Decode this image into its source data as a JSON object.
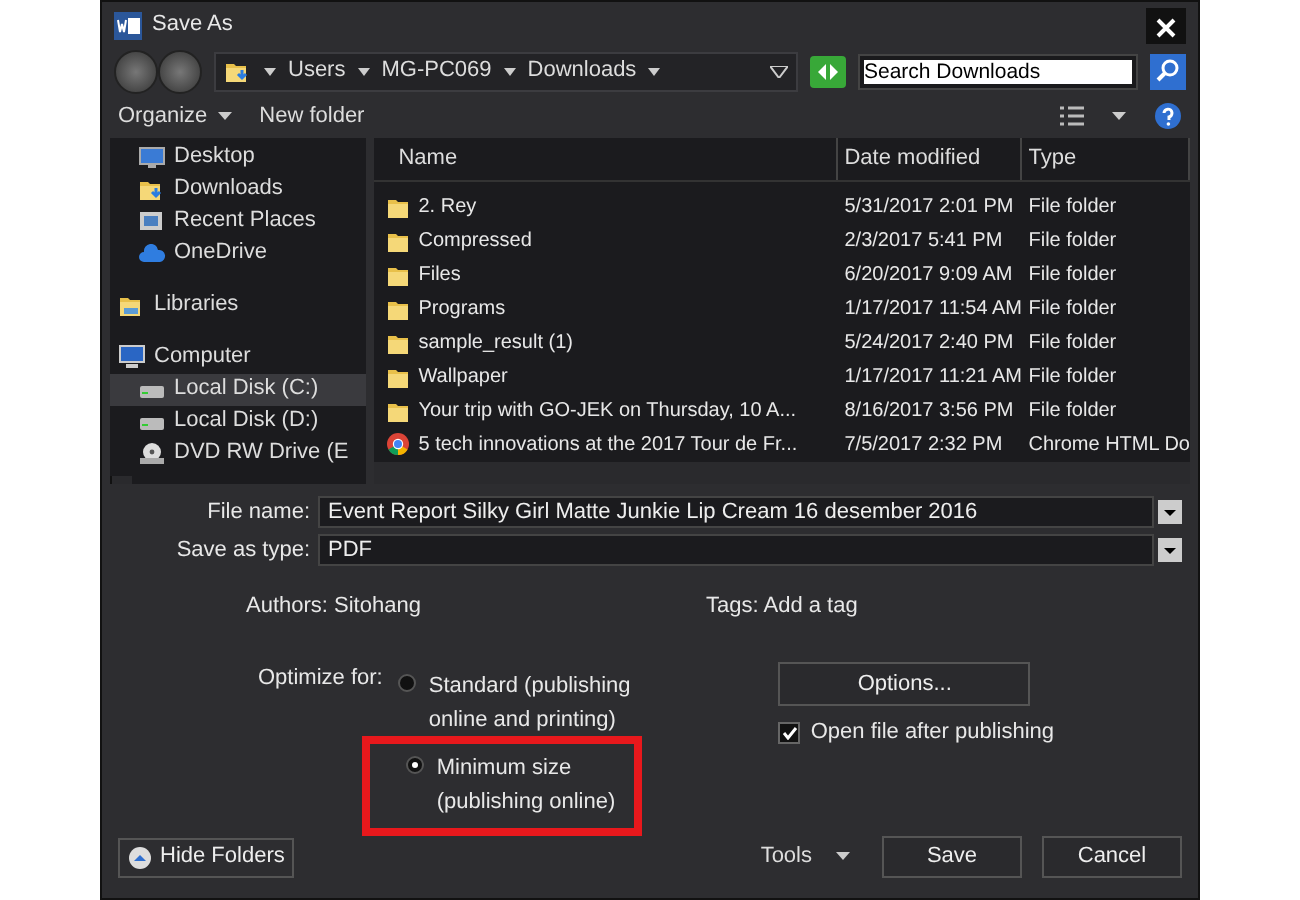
{
  "window": {
    "title": "Save As"
  },
  "address_bar": {
    "crumbs": [
      "Users",
      "MG-PC069",
      "Downloads"
    ]
  },
  "search": {
    "placeholder": "Search Downloads",
    "selected": true
  },
  "toolbar": {
    "buttons": [
      "Organize",
      "New folder"
    ]
  },
  "sidebar": {
    "favorites": [
      {
        "label": "Desktop",
        "kind": "desktop",
        "selected": false
      },
      {
        "label": "Downloads",
        "kind": "downloads",
        "selected": false
      },
      {
        "label": "Recent Places",
        "kind": "recent",
        "selected": false
      },
      {
        "label": "OneDrive",
        "kind": "cloud",
        "selected": false
      }
    ],
    "items": [
      {
        "label": "Libraries",
        "kind": "library",
        "selected": false
      },
      {
        "label": "Computer",
        "kind": "computer",
        "selected": false,
        "children": [
          {
            "label": "Local Disk (C:)",
            "kind": "disk",
            "selected": true
          },
          {
            "label": "Local Disk (D:)",
            "kind": "disk",
            "selected": false
          },
          {
            "label": "DVD RW Drive (E",
            "kind": "dvd",
            "selected": false
          }
        ]
      }
    ]
  },
  "file_list": {
    "columns": [
      "Name",
      "Date modified",
      "Type"
    ],
    "rows": [
      {
        "kind": "folder",
        "name": "2. Rey",
        "date": "5/31/2017 2:01 PM",
        "type": "File folder"
      },
      {
        "kind": "folder",
        "name": "Compressed",
        "date": "2/3/2017 5:41 PM",
        "type": "File folder"
      },
      {
        "kind": "folder",
        "name": "Files",
        "date": "6/20/2017 9:09 AM",
        "type": "File folder"
      },
      {
        "kind": "folder",
        "name": "Programs",
        "date": "1/17/2017 11:54 AM",
        "type": "File folder"
      },
      {
        "kind": "folder",
        "name": "sample_result (1)",
        "date": "5/24/2017 2:40 PM",
        "type": "File folder"
      },
      {
        "kind": "folder",
        "name": "Wallpaper",
        "date": "1/17/2017 11:21 AM",
        "type": "File folder"
      },
      {
        "kind": "folder",
        "name": "Your trip with GO-JEK on Thursday, 10 A...",
        "date": "8/16/2017 3:56 PM",
        "type": "File folder"
      },
      {
        "kind": "chrome",
        "name": "5 tech innovations at the 2017 Tour de Fr...",
        "date": "7/5/2017 2:32 PM",
        "type": "Chrome HTML Do"
      }
    ]
  },
  "file_name": {
    "label": "File name:",
    "value": "Event Report Silky Girl Matte Junkie Lip Cream 16 desember 2016"
  },
  "save_as_type": {
    "label": "Save as type:",
    "value": "PDF"
  },
  "authors": {
    "label": "Authors:",
    "value": "Sitohang"
  },
  "tags": {
    "label": "Tags:",
    "value": "Add a tag"
  },
  "optimize": {
    "label": "Optimize for:",
    "options": [
      {
        "label": "Standard (publishing online and printing)",
        "selected": false,
        "highlighted": false
      },
      {
        "label": "Minimum size (publishing online)",
        "selected": true,
        "highlighted": true
      }
    ]
  },
  "options_button": "Options...",
  "open_after": {
    "label": "Open file after publishing",
    "checked": true
  },
  "hide_folders": "Hide Folders",
  "tools": "Tools",
  "buttons": [
    "Save",
    "Cancel"
  ]
}
